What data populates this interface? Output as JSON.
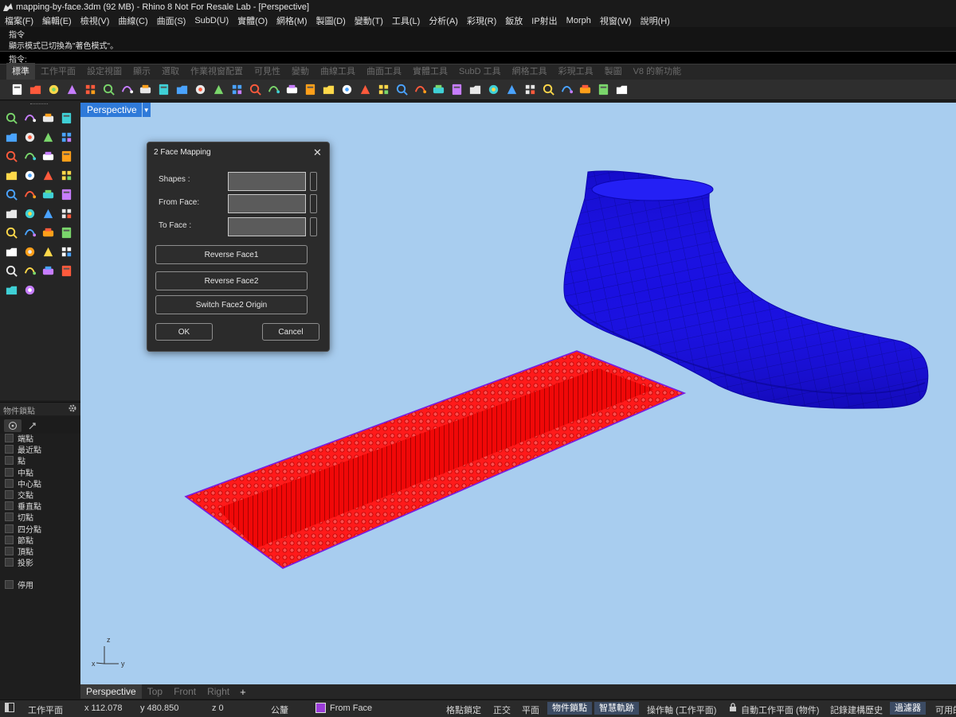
{
  "window": {
    "title": "mapping-by-face.3dm (92 MB) - Rhino 8 Not For Resale Lab - [Perspective]"
  },
  "menu": [
    "檔案(F)",
    "編輯(E)",
    "檢視(V)",
    "曲線(C)",
    "曲面(S)",
    "SubD(U)",
    "實體(O)",
    "網格(M)",
    "製圖(D)",
    "變動(T)",
    "工具(L)",
    "分析(A)",
    "彩現(R)",
    "鈑放",
    "IP射出",
    "Morph",
    "視窗(W)",
    "說明(H)"
  ],
  "command": {
    "history": [
      "指令",
      "顯示模式已切換為\"著色模式\"。"
    ],
    "prompt_label": "指令:",
    "value": ""
  },
  "toolbar_tabs": [
    "標準",
    "工作平面",
    "設定視圖",
    "顯示",
    "選取",
    "作業視窗配置",
    "可見性",
    "變動",
    "曲線工具",
    "曲面工具",
    "實體工具",
    "SubD 工具",
    "網格工具",
    "彩現工具",
    "製圖",
    "V8 的新功能"
  ],
  "toolbar_icons": [
    "new-file-icon",
    "open-folder-icon",
    "save-icon",
    "print-icon",
    "import-icon",
    "cut-icon",
    "copy-icon",
    "paste-icon",
    "undo-icon",
    "pan-hand-icon",
    "rotate-view-icon",
    "zoom-icon",
    "zoom-window-icon",
    "zoom-extents-icon",
    "zoom-selected-icon",
    "rotate-icon",
    "four-viewports-icon",
    "car-icon",
    "layer-icon",
    "point-icon",
    "snap-icon",
    "light-bulb-icon",
    "lock-icon",
    "material-icon",
    "color-wheel-icon",
    "render-icon",
    "grid-icon",
    "sphere-icon",
    "render-preview-icon",
    "sun-icon",
    "dimension-icon",
    "green-globe-icon",
    "help-icon",
    "chat-icon"
  ],
  "left_tools": [
    "select-arrow-icon",
    "point-icon",
    "polyline-icon",
    "curve-icon",
    "circle-icon",
    "ellipse-icon",
    "arc-icon",
    "rectangle-icon",
    "polygon-icon",
    "curve-from-object-icon",
    "extrude-surface-icon",
    "rotate-surface-icon",
    "box-icon",
    "boolean-icon",
    "cylinder-icon",
    "mesh-icon",
    "transform-icon",
    "fire-icon",
    "dimension-icon",
    "align-icon",
    "render-icon",
    "array-icon",
    "curve-edit-icon",
    "point-edit-icon",
    "text-icon",
    "move-icon",
    "group-icon",
    "mirror-icon",
    "solid-box-icon",
    "dimension-linear-icon",
    "grid-array-icon",
    "bar-icon",
    "block-icon",
    "trim-icon",
    "check-icon",
    "cut-surface-icon",
    "small-icon",
    "lightning-icon"
  ],
  "osnap": {
    "title": "物件鎖點",
    "items": [
      "端點",
      "最近點",
      "點",
      "中點",
      "中心點",
      "交點",
      "垂直點",
      "切點",
      "四分點",
      "節點",
      "頂點",
      "投影"
    ],
    "disable": "停用"
  },
  "viewport": {
    "name": "Perspective",
    "axis_labels": {
      "z": "z",
      "x": "x",
      "y": "y"
    }
  },
  "dialog": {
    "title": "2 Face Mapping",
    "fields": [
      {
        "label": "Shapes  :",
        "value": ""
      },
      {
        "label": "From Face:",
        "value": ""
      },
      {
        "label": "To  Face :",
        "value": ""
      }
    ],
    "buttons": {
      "reverse1": "Reverse Face1",
      "reverse2": "Reverse Face2",
      "switch_origin": "Switch Face2 Origin",
      "ok": "OK",
      "cancel": "Cancel"
    }
  },
  "viewport_tabs": [
    "Perspective",
    "Top",
    "Front",
    "Right"
  ],
  "status": {
    "cplane": "工作平面",
    "x": "x 112.078",
    "y": "y 480.850",
    "z": "z 0",
    "units": "公釐",
    "layer": "From Face",
    "layer_color": "#9b3cd8",
    "grid_snap": "格點鎖定",
    "ortho": "正交",
    "planar": "平面",
    "osnap": "物件鎖點",
    "smarttrack": "智慧軌跡",
    "gumball": "操作軸 (工作平面)",
    "auto_cplane": "自動工作平面 (物件)",
    "history": "記錄建構歷史",
    "filter": "過濾器",
    "available": "可用的"
  },
  "colors": {
    "viewport_bg": "#a8cdef",
    "shoe": "#1a10e0",
    "strip": "#ff0000",
    "active_tab": "#2f7ad9"
  }
}
